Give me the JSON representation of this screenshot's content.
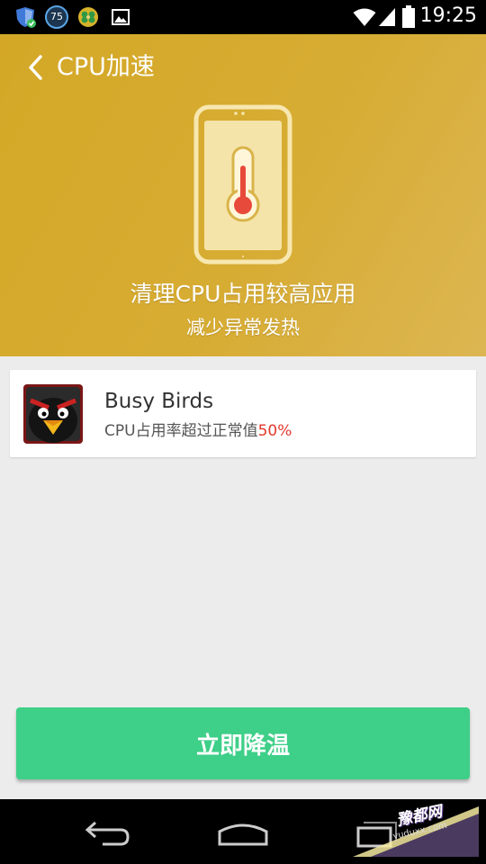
{
  "status_bar": {
    "time": "19:25",
    "notification_badge": "75",
    "icons": [
      "shield-icon",
      "badge-75-icon",
      "clover-icon",
      "image-icon",
      "wifi-icon",
      "signal-icon",
      "battery-icon"
    ]
  },
  "header": {
    "title": "CPU加速",
    "headline": "清理CPU占用较高应用",
    "subline": "减少异常发热",
    "hero_icon": "phone-thermometer-icon"
  },
  "app_list": [
    {
      "name": "Busy Birds",
      "desc_prefix": "CPU占用率超过正常值",
      "desc_value": "50%"
    }
  ],
  "action": {
    "label": "立即降温"
  },
  "nav_bar": {
    "icons": [
      "back-icon",
      "home-icon",
      "recents-icon"
    ],
    "watermark": "豫都网",
    "watermark_url": "yuduxx.com"
  },
  "colors": {
    "header": "#d4a826",
    "button": "#3ecf88",
    "highlight": "#e53a2f",
    "background": "#ececec"
  }
}
